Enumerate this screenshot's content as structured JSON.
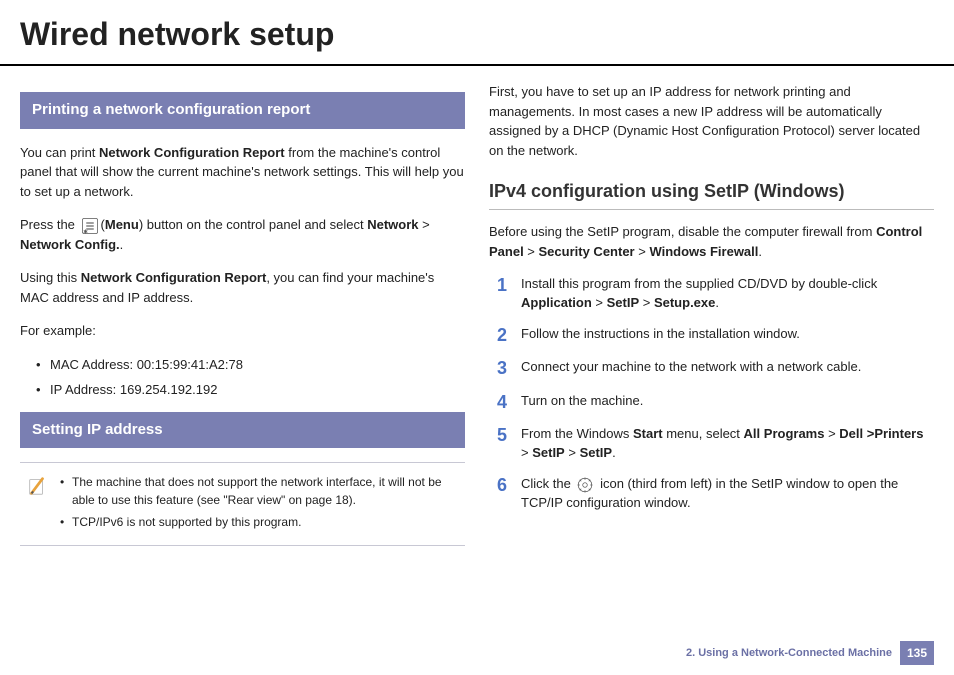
{
  "title": "Wired network setup",
  "left": {
    "section1_head": "Printing a network configuration report",
    "p1_pre": "You can print ",
    "p1_bold": "Network Configuration Report",
    "p1_post": " from the machine's control panel that will show the current machine's network settings. This will help you to set up a network.",
    "p2_pre": "Press the ",
    "p2_icon_label": "Menu",
    "p2_mid": ") button on the control panel and select ",
    "p2_b1": "Network",
    "p2_gt": " > ",
    "p2_b2": "Network Config.",
    "p2_end": ".",
    "p3_pre": "Using this ",
    "p3_bold": "Network Configuration Report",
    "p3_post": ", you can find your machine's MAC address and IP address.",
    "p4": "For example:",
    "bullets": [
      "MAC Address: 00:15:99:41:A2:78",
      "IP Address: 169.254.192.192"
    ],
    "section2_head": "Setting IP address",
    "note_bullets": [
      "The machine that does not support the network interface, it will not be able to use this feature (see \"Rear view\" on page 18).",
      "TCP/IPv6 is not supported by this program."
    ]
  },
  "right": {
    "intro": "First, you have to set up an IP address for network printing and managements. In most cases a new IP address will be automatically assigned by a DHCP (Dynamic Host Configuration Protocol) server located on the network.",
    "sub_head": "IPv4 configuration using SetIP (Windows)",
    "pre_steps_pre": "Before using the SetIP program, disable the computer firewall from ",
    "pre_b1": "Control Panel",
    "pre_gt": " > ",
    "pre_b2": "Security Center",
    "pre_b3": "Windows Firewall",
    "pre_end": ".",
    "steps": [
      {
        "n": "1",
        "pre": "Install this program from the supplied CD/DVD by double-click ",
        "b1": "Application",
        "gt": " > ",
        "b2": "SetIP",
        "b3": "Setup.exe",
        "end": "."
      },
      {
        "n": "2",
        "text": "Follow the instructions in the installation window."
      },
      {
        "n": "3",
        "text": "Connect your machine to the network with a network cable."
      },
      {
        "n": "4",
        "text": "Turn on the machine."
      },
      {
        "n": "5",
        "pre": "From the Windows ",
        "b0": "Start",
        "mid": " menu, select ",
        "b1": "All Programs",
        "gt": " >  ",
        "b2": "Dell >Printers",
        "b3": "SetIP",
        "b4": "SetIP",
        "end": "."
      },
      {
        "n": "6",
        "pre": "Click the ",
        "post": " icon (third from left) in the SetIP window to open the TCP/IP configuration window."
      }
    ]
  },
  "footer": {
    "chapter": "2.  Using a Network-Connected Machine",
    "page": "135"
  }
}
